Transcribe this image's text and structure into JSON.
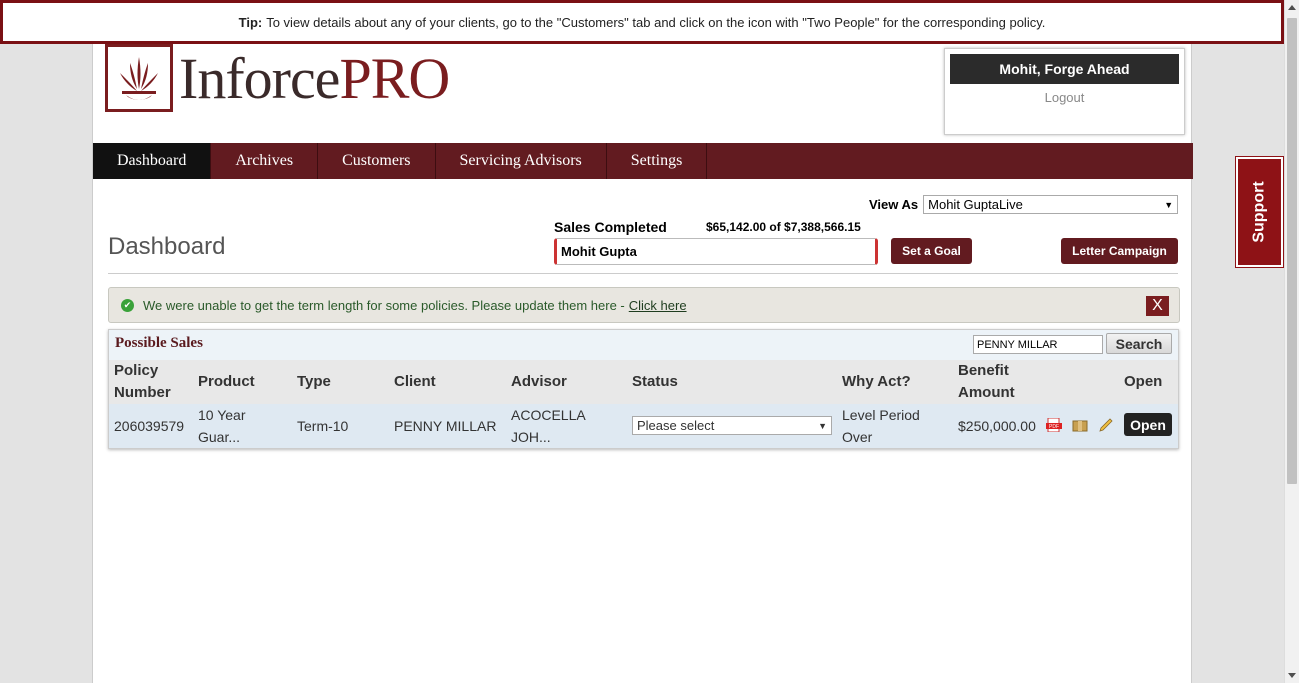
{
  "tip": {
    "label": "Tip:",
    "text": "To view details about any of your clients, go to the \"Customers\" tab and click on the icon with \"Two People\" for the corresponding policy."
  },
  "brand": {
    "name_main": "Inforce",
    "name_accent": "PRO"
  },
  "user": {
    "name": "Mohit, Forge Ahead",
    "logout": "Logout"
  },
  "nav": {
    "tabs": [
      {
        "label": "Dashboard",
        "active": true
      },
      {
        "label": "Archives"
      },
      {
        "label": "Customers"
      },
      {
        "label": "Servicing Advisors"
      },
      {
        "label": "Settings"
      }
    ]
  },
  "view_as": {
    "label": "View As",
    "selected": "Mohit GuptaLive"
  },
  "page_title": "Dashboard",
  "sales": {
    "label": "Sales Completed",
    "value": "$65,142.00 of $7,388,566.15",
    "bar_name": "Mohit Gupta"
  },
  "buttons": {
    "set_goal": "Set a Goal",
    "letter_campaign": "Letter Campaign"
  },
  "alert": {
    "text": "We were unable to get the term length for some policies. Please update them here -",
    "link": "Click here",
    "close": "X"
  },
  "possible_sales": {
    "title": "Possible Sales",
    "search_value": "PENNY MILLAR",
    "search_button": "Search",
    "columns": {
      "policy_number_1": "Policy",
      "policy_number_2": "Number",
      "product": "Product",
      "type": "Type",
      "client": "Client",
      "advisor": "Advisor",
      "status": "Status",
      "why_act": "Why Act?",
      "benefit_1": "Benefit",
      "benefit_2": "Amount",
      "open": "Open"
    },
    "rows": [
      {
        "policy_number": "206039579",
        "product_1": "10 Year",
        "product_2": "Guar...",
        "type": "Term-10",
        "client": "PENNY MILLAR",
        "advisor_1": "ACOCELLA",
        "advisor_2": "JOH...",
        "status": "Please select",
        "why_act_1": "Level Period",
        "why_act_2": "Over",
        "benefit": "$250,000.00",
        "open": "Open"
      }
    ]
  },
  "support": "Support",
  "colors": {
    "brand": "#621b20",
    "accent": "#8e1216"
  }
}
